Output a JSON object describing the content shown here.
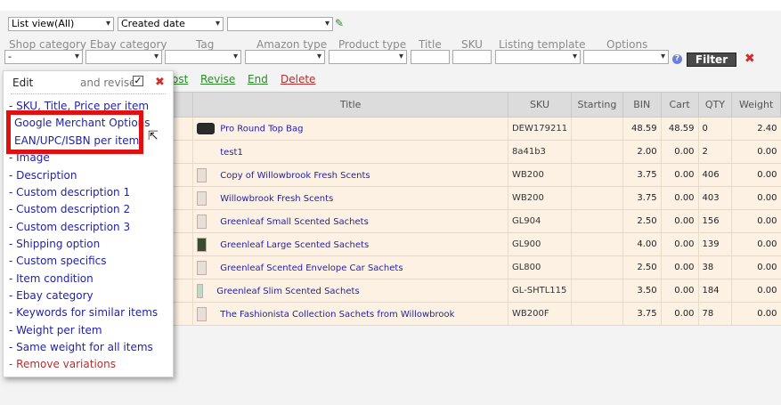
{
  "filters": {
    "view_select": "List view(All)",
    "sort_select": "Created date",
    "third_select": "",
    "labels": [
      "Shop category",
      "Ebay category",
      "Tag",
      "Amazon type",
      "Product type",
      "Title",
      "SKU",
      "Listing template",
      "Options"
    ],
    "shop_category_value": "-",
    "filter_button": "Filter"
  },
  "actions": {
    "list_partial": "ost",
    "revise": "Revise",
    "end": "End",
    "delete": "Delete"
  },
  "table": {
    "headers": [
      "",
      "Title",
      "SKU",
      "Starting",
      "BIN",
      "Cart",
      "QTY",
      "Weight"
    ],
    "rows": [
      {
        "thumb": "bag",
        "title": "Pro Round Top Bag",
        "sku": "DEW179211",
        "starting": "",
        "bin": "48.59",
        "cart": "48.59",
        "qty": "0",
        "weight": "2.40"
      },
      {
        "thumb": "none",
        "title": "test1",
        "sku": "8a41b3",
        "starting": "",
        "bin": "2.00",
        "cart": "0.00",
        "qty": "2",
        "weight": "0.00"
      },
      {
        "thumb": "box",
        "title": "Copy of Willowbrook Fresh Scents",
        "sku": "WB200",
        "starting": "",
        "bin": "3.75",
        "cart": "0.00",
        "qty": "406",
        "weight": "0.00"
      },
      {
        "thumb": "box",
        "title": "Willowbrook Fresh Scents",
        "sku": "WB200",
        "starting": "",
        "bin": "3.75",
        "cart": "0.00",
        "qty": "403",
        "weight": "0.00"
      },
      {
        "thumb": "box",
        "title": "Greenleaf Small Scented Sachets",
        "sku": "GL904",
        "starting": "",
        "bin": "2.50",
        "cart": "0.00",
        "qty": "156",
        "weight": "0.00"
      },
      {
        "thumb": "dark",
        "title": "Greenleaf Large Scented Sachets",
        "sku": "GL900",
        "starting": "",
        "bin": "4.00",
        "cart": "0.00",
        "qty": "139",
        "weight": "0.00"
      },
      {
        "thumb": "box",
        "title": "Greenleaf Scented Envelope Car Sachets",
        "sku": "GL800",
        "starting": "",
        "bin": "2.50",
        "cart": "0.00",
        "qty": "38",
        "weight": "0.00"
      },
      {
        "thumb": "tall",
        "title": "Greenleaf Slim Scented Sachets",
        "sku": "GL-SHTL115",
        "starting": "",
        "bin": "3.50",
        "cart": "0.00",
        "qty": "184",
        "weight": "0.00"
      },
      {
        "thumb": "box",
        "title": "The Fashionista Collection Sachets from Willowbrook",
        "sku": "WB200F",
        "starting": "",
        "bin": "3.75",
        "cart": "0.00",
        "qty": "78",
        "weight": "0.00"
      }
    ]
  },
  "menu": {
    "title": "Edit",
    "and_revise": "and revise",
    "checked_mark": "✓",
    "items": [
      {
        "label": "- SKU, Title, Price per item"
      },
      {
        "label": "Google Merchant Options"
      },
      {
        "label": "EAN/UPC/ISBN per item"
      },
      {
        "label": "- Image"
      },
      {
        "label": "- Description"
      },
      {
        "label": "- Custom description 1"
      },
      {
        "label": "- Custom description 2"
      },
      {
        "label": "- Custom description 3"
      },
      {
        "label": "- Shipping option"
      },
      {
        "label": "- Custom specifics"
      },
      {
        "label": "- Item condition"
      },
      {
        "label": "- Ebay category"
      },
      {
        "label": "- Keywords for similar items"
      },
      {
        "label": "- Weight per item"
      },
      {
        "label": "- Same weight for all items"
      },
      {
        "label": "- Remove variations"
      }
    ]
  },
  "icons": {
    "pin": "pin-icon",
    "help": "help-icon",
    "close": "close-icon",
    "cursor": "mouse-cursor-icon"
  },
  "colors": {
    "highlight": "#e01010",
    "link": "#2222aa",
    "action_link": "#2a8a2a",
    "delete_link": "#b03030",
    "row_bg": "#fdf1e3"
  }
}
